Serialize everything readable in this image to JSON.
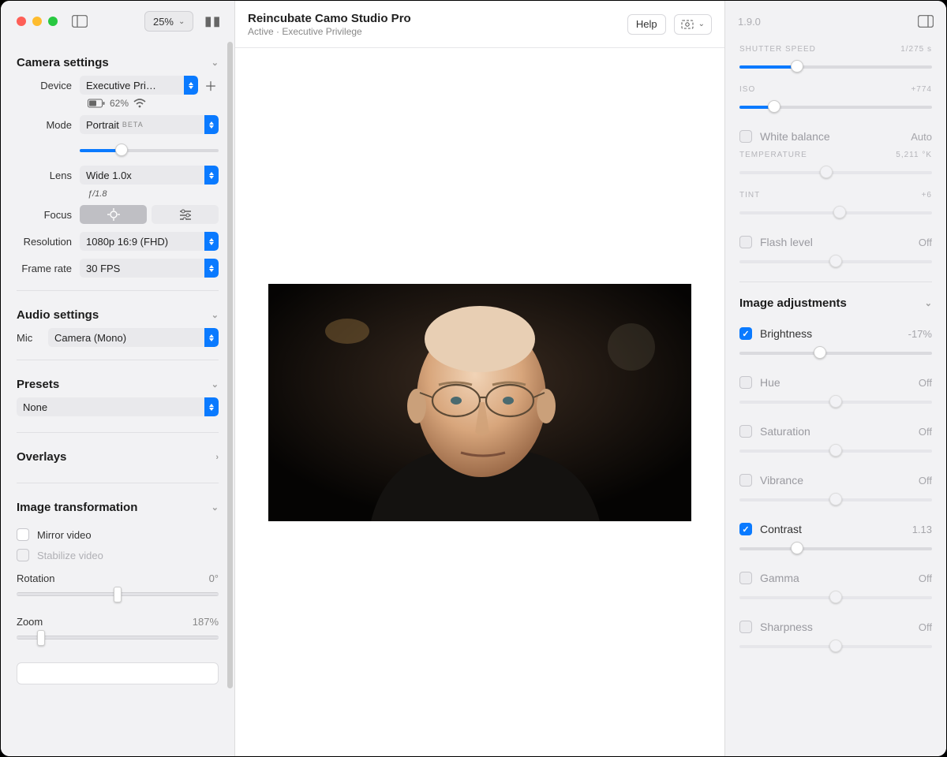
{
  "toolbar": {
    "zoom": "25%"
  },
  "header": {
    "title": "Reincubate Camo Studio Pro",
    "subtitle": "Active · Executive Privilege",
    "help": "Help",
    "version": "1.9.0"
  },
  "camera": {
    "section": "Camera settings",
    "device_label": "Device",
    "device_value": "Executive Pri…",
    "battery": "62%",
    "mode_label": "Mode",
    "mode_value": "Portrait",
    "mode_badge": "BETA",
    "mode_slider_pct": 30,
    "lens_label": "Lens",
    "lens_value": "Wide 1.0x",
    "aperture": "ƒ/1.8",
    "focus_label": "Focus",
    "resolution_label": "Resolution",
    "resolution_value": "1080p 16:9 (FHD)",
    "framerate_label": "Frame rate",
    "framerate_value": "30 FPS"
  },
  "audio": {
    "section": "Audio settings",
    "mic_label": "Mic",
    "mic_value": "Camera (Mono)"
  },
  "presets": {
    "section": "Presets",
    "value": "None"
  },
  "overlays": {
    "section": "Overlays"
  },
  "transform": {
    "section": "Image transformation",
    "mirror": "Mirror video",
    "stabilize": "Stabilize video",
    "rotation_label": "Rotation",
    "rotation_value": "0°",
    "rotation_pct": 50,
    "zoom_label": "Zoom",
    "zoom_value": "187%",
    "zoom_pct": 12
  },
  "rpanel": {
    "shutter_label": "SHUTTER SPEED",
    "shutter_value": "1/275 s",
    "shutter_pct": 30,
    "iso_label": "ISO",
    "iso_value": "+774",
    "iso_pct": 18,
    "wb_label": "White balance",
    "wb_value": "Auto",
    "temp_label": "TEMPERATURE",
    "temp_value": "5,211 °K",
    "temp_pct": 45,
    "tint_label": "TINT",
    "tint_value": "+6",
    "tint_pct": 52,
    "flash_label": "Flash level",
    "flash_value": "Off",
    "flash_pct": 50,
    "adj_section": "Image adjustments",
    "brightness_label": "Brightness",
    "brightness_value": "-17%",
    "brightness_pct": 42,
    "hue_label": "Hue",
    "hue_value": "Off",
    "hue_pct": 50,
    "sat_label": "Saturation",
    "sat_value": "Off",
    "sat_pct": 50,
    "vib_label": "Vibrance",
    "vib_value": "Off",
    "vib_pct": 50,
    "contrast_label": "Contrast",
    "contrast_value": "1.13",
    "contrast_pct": 30,
    "gamma_label": "Gamma",
    "gamma_value": "Off",
    "gamma_pct": 50,
    "sharp_label": "Sharpness",
    "sharp_value": "Off",
    "sharp_pct": 50
  }
}
